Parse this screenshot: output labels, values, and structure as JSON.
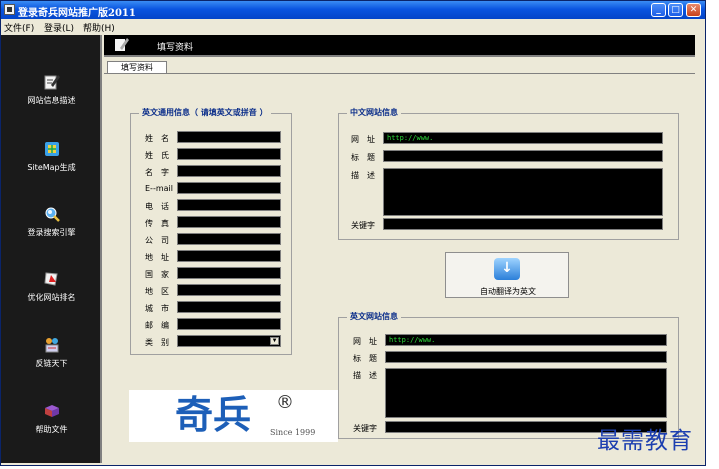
{
  "window": {
    "title": "登录奇兵网站推广版2011",
    "minimize_glyph": "_",
    "maximize_glyph": "□",
    "close_glyph": "✕"
  },
  "menu": [
    "文件(F)",
    "登录(L)",
    "帮助(H)"
  ],
  "sidebar": [
    {
      "label": "网站信息描述",
      "icon": "edit-info-icon"
    },
    {
      "label": "SiteMap生成",
      "icon": "sitemap-icon"
    },
    {
      "label": "登录搜索引擎",
      "icon": "search-engine-icon"
    },
    {
      "label": "优化网站排名",
      "icon": "rank-optimize-icon"
    },
    {
      "label": "反链天下",
      "icon": "backlink-icon"
    },
    {
      "label": "帮助文件",
      "icon": "help-book-icon"
    }
  ],
  "header": {
    "title": "填写资料"
  },
  "tab": {
    "label": "填写资料"
  },
  "english_personal": {
    "title": "英文通用信息（ 请填英文或拼音 ）",
    "fields": [
      {
        "label": "姓　名",
        "value": ""
      },
      {
        "label": "姓　氏",
        "value": ""
      },
      {
        "label": "名　字",
        "value": ""
      },
      {
        "label": "E--mail",
        "value": ""
      },
      {
        "label": "电　话",
        "value": ""
      },
      {
        "label": "传　真",
        "value": ""
      },
      {
        "label": "公　司",
        "value": ""
      },
      {
        "label": "地　址",
        "value": ""
      },
      {
        "label": "国　家",
        "value": ""
      },
      {
        "label": "地　区",
        "value": ""
      },
      {
        "label": "城　市",
        "value": ""
      },
      {
        "label": "邮　编",
        "value": ""
      },
      {
        "label": "类　别",
        "value": ""
      }
    ]
  },
  "chinese_site": {
    "title": "中文网站信息",
    "url_label": "网　址",
    "url_value": "http://www.",
    "title_label": "标　题",
    "title_value": "",
    "desc_label": "描　述",
    "desc_value": "",
    "keywords_label": "关键字",
    "keywords_value": ""
  },
  "translate_button": {
    "label": "自动翻译为英文"
  },
  "english_site": {
    "title": "英文网站信息",
    "url_label": "网　址",
    "url_value": "http://www.",
    "title_label": "标　题",
    "title_value": "",
    "desc_label": "描　述",
    "desc_value": "",
    "keywords_label": "关键字",
    "keywords_value": ""
  },
  "logo": {
    "text": "奇兵",
    "reg": "®",
    "since": "Since 1999"
  },
  "watermark": "最需教育",
  "colors": {
    "field_text": "#2cd83a",
    "titlebar": "#0a55e0",
    "sidebar_bg": "#1a1a1a"
  }
}
